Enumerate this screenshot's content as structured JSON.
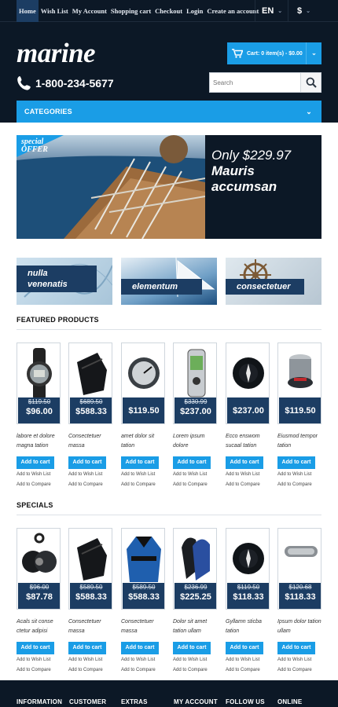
{
  "topnav": {
    "links": [
      "Home",
      "Wish List",
      "My Account",
      "Shopping cart",
      "Checkout",
      "Login",
      "Create an account"
    ],
    "language": "EN",
    "currency": "$"
  },
  "header": {
    "logo": "marine",
    "phone": "1-800-234-5677",
    "cart_label": "Cart: 0 item(s) - $0.00",
    "search_placeholder": "Search",
    "categories_label": "CATEGORIES"
  },
  "banner": {
    "offer_line1": "special",
    "offer_line2": "OFFER",
    "price": "Only $229.97",
    "title_line1": "Mauris",
    "title_line2": "accumsan"
  },
  "promos": [
    {
      "line1": "nulla",
      "line2": "venenatis"
    },
    {
      "line1": "elementum",
      "line2": ""
    },
    {
      "line1": "consectetuer",
      "line2": ""
    }
  ],
  "featured": {
    "title": "FEATURED PRODUCTS",
    "products": [
      {
        "name": "labore et dolore magna tation ullamcorper",
        "old_price": "$119.50",
        "price": "$96.00",
        "icon": "watch-icon"
      },
      {
        "name": "Consectetuer massa",
        "old_price": "$689.50",
        "price": "$588.33",
        "icon": "neoprene-glove-icon"
      },
      {
        "name": "amet dolor sit tation",
        "old_price": "",
        "price": "$119.50",
        "icon": "gauge-icon"
      },
      {
        "name": "Lorem ipsum dolore",
        "old_price": "$330.99",
        "price": "$237.00",
        "icon": "gps-device-icon"
      },
      {
        "name": "Ecco enswom sucaal tation",
        "old_price": "",
        "price": "$237.00",
        "icon": "compass-icon"
      },
      {
        "name": "Eiusmod tempor tation",
        "old_price": "",
        "price": "$119.50",
        "icon": "winch-icon"
      }
    ]
  },
  "specials": {
    "title": "SPECIALS",
    "products": [
      {
        "name": "Acals sit conse ctetur adipisi",
        "old_price": "$96.00",
        "price": "$87.78",
        "icon": "pulley-block-icon"
      },
      {
        "name": "Consectetuer massa",
        "old_price": "$589.50",
        "price": "$588.33",
        "icon": "neoprene-glove-icon"
      },
      {
        "name": "Consectetuer massa",
        "old_price": "$589.50",
        "price": "$588.33",
        "icon": "jacket-icon"
      },
      {
        "name": "Dolor sit amet tation ullam",
        "old_price": "$236.99",
        "price": "$225.25",
        "icon": "gloves-icon"
      },
      {
        "name": "Gyllamn sticba tation",
        "old_price": "$119.50",
        "price": "$118.33",
        "icon": "compass-icon"
      },
      {
        "name": "Ipsum dolor tation ullam",
        "old_price": "$120.68",
        "price": "$118.33",
        "icon": "rail-icon"
      }
    ]
  },
  "product_actions": {
    "add_to_cart": "Add to cart",
    "wish_list": "Add to Wish List",
    "compare": "Add to Compare"
  },
  "footer": {
    "headings": [
      "INFORMATION",
      "CUSTOMER",
      "EXTRAS",
      "MY ACCOUNT",
      "FOLLOW US",
      "ONLINE"
    ]
  },
  "colors": {
    "dark_navy": "#0c1826",
    "accent_blue": "#1a9de6",
    "price_navy": "#1c3d63"
  }
}
